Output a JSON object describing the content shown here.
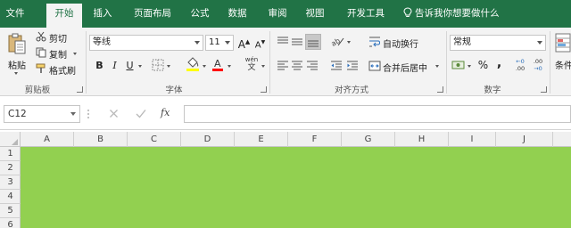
{
  "tabs": [
    {
      "label": "文件",
      "active": false
    },
    {
      "label": "开始",
      "active": true
    },
    {
      "label": "插入",
      "active": false
    },
    {
      "label": "页面布局",
      "active": false
    },
    {
      "label": "公式",
      "active": false
    },
    {
      "label": "数据",
      "active": false
    },
    {
      "label": "审阅",
      "active": false
    },
    {
      "label": "视图",
      "active": false
    },
    {
      "label": "开发工具",
      "active": false
    }
  ],
  "tell_me": "告诉我你想要做什么",
  "clipboard": {
    "paste": "粘贴",
    "cut": "剪切",
    "copy": "复制",
    "format_painter": "格式刷",
    "group_label": "剪贴板"
  },
  "font": {
    "name": "等线",
    "size": "11",
    "bold": "B",
    "italic": "I",
    "underline": "U",
    "grow": "A",
    "shrink": "A",
    "phonetic_top": "wén",
    "phonetic_bottom": "文",
    "group_label": "字体",
    "fill_color": "#ffff00",
    "font_color": "#ff0000"
  },
  "alignment": {
    "wrap_text": "自动换行",
    "merge_center": "合并后居中",
    "group_label": "对齐方式"
  },
  "number": {
    "format": "常规",
    "percent": "%",
    "comma": ",",
    "inc_decimal_top": "←0",
    "inc_decimal_bottom": ".00",
    "dec_decimal_top": ".00",
    "dec_decimal_bottom": "→0",
    "group_label": "数字"
  },
  "styles": {
    "conditional_label": "条件"
  },
  "formula_bar": {
    "name_box": "C12",
    "fx": "fx",
    "formula": ""
  },
  "sheet": {
    "columns": [
      "A",
      "B",
      "C",
      "D",
      "E",
      "F",
      "G",
      "H",
      "I",
      "J"
    ],
    "rows": [
      "1",
      "2",
      "3",
      "4",
      "5",
      "6"
    ],
    "fill_color": "#92d050"
  },
  "colors": {
    "brand": "#217346"
  }
}
